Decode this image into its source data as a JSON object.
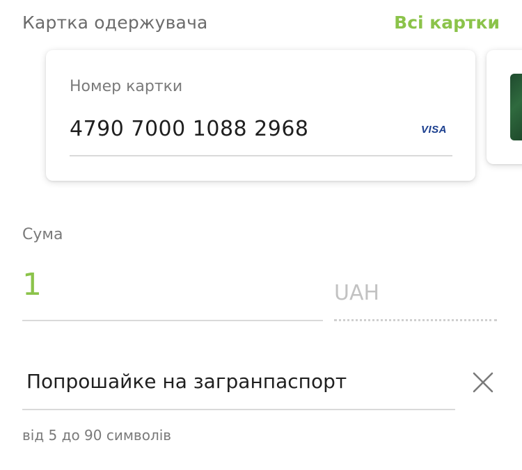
{
  "header": {
    "title": "Картка одержувача",
    "all_cards_link": "Всі картки"
  },
  "card": {
    "field_label": "Номер картки",
    "number": "4790 7000 1088 2968",
    "brand": "VISA"
  },
  "amount": {
    "label": "Сума",
    "value": "1",
    "currency": "UAH"
  },
  "comment": {
    "value": "Попрошайке на загранпаспорт",
    "hint": "від 5 до 90 символів",
    "clear_icon": "close-icon"
  },
  "colors": {
    "accent": "#8bc34a",
    "visa": "#1a3e8e"
  }
}
